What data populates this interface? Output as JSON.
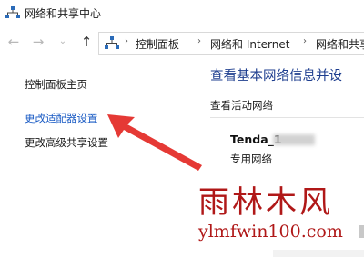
{
  "window": {
    "title": "网络和共享中心",
    "icon": "network-center-icon"
  },
  "nav": {
    "back_icon": "back-arrow-icon",
    "forward_icon": "forward-arrow-icon",
    "recent_icon": "recent-dropdown-icon",
    "up_icon": "up-arrow-icon"
  },
  "address": {
    "crumbs": [
      "控制面板",
      "网络和 Internet",
      "网络和共享中"
    ]
  },
  "sidebar": {
    "items": [
      {
        "label": "控制面板主页"
      },
      {
        "label": "更改适配器设置"
      },
      {
        "label": "更改高级共享设置"
      }
    ]
  },
  "main": {
    "title": "查看基本网络信息并设",
    "section_label": "查看活动网络",
    "network": {
      "name": "Tenda_1",
      "type": "专用网络"
    }
  },
  "watermark": {
    "text_cn": "雨林木风",
    "text_en": "ylmfwin100.com"
  },
  "colors": {
    "link": "#1a5bc4",
    "title": "#1e3e8f",
    "arrow": "#e53935",
    "watermark": "#b01818"
  }
}
